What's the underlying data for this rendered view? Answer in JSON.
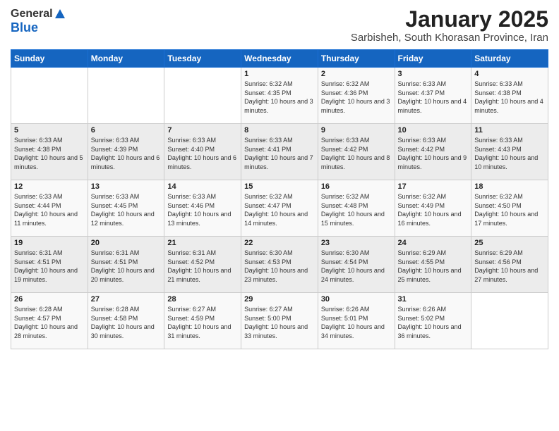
{
  "header": {
    "logo_general": "General",
    "logo_blue": "Blue",
    "title": "January 2025",
    "subtitle": "Sarbisheh, South Khorasan Province, Iran"
  },
  "days_of_week": [
    "Sunday",
    "Monday",
    "Tuesday",
    "Wednesday",
    "Thursday",
    "Friday",
    "Saturday"
  ],
  "weeks": [
    [
      {
        "day": "",
        "info": ""
      },
      {
        "day": "",
        "info": ""
      },
      {
        "day": "",
        "info": ""
      },
      {
        "day": "1",
        "info": "Sunrise: 6:32 AM\nSunset: 4:35 PM\nDaylight: 10 hours and 3 minutes."
      },
      {
        "day": "2",
        "info": "Sunrise: 6:32 AM\nSunset: 4:36 PM\nDaylight: 10 hours and 3 minutes."
      },
      {
        "day": "3",
        "info": "Sunrise: 6:33 AM\nSunset: 4:37 PM\nDaylight: 10 hours and 4 minutes."
      },
      {
        "day": "4",
        "info": "Sunrise: 6:33 AM\nSunset: 4:38 PM\nDaylight: 10 hours and 4 minutes."
      }
    ],
    [
      {
        "day": "5",
        "info": "Sunrise: 6:33 AM\nSunset: 4:38 PM\nDaylight: 10 hours and 5 minutes."
      },
      {
        "day": "6",
        "info": "Sunrise: 6:33 AM\nSunset: 4:39 PM\nDaylight: 10 hours and 6 minutes."
      },
      {
        "day": "7",
        "info": "Sunrise: 6:33 AM\nSunset: 4:40 PM\nDaylight: 10 hours and 6 minutes."
      },
      {
        "day": "8",
        "info": "Sunrise: 6:33 AM\nSunset: 4:41 PM\nDaylight: 10 hours and 7 minutes."
      },
      {
        "day": "9",
        "info": "Sunrise: 6:33 AM\nSunset: 4:42 PM\nDaylight: 10 hours and 8 minutes."
      },
      {
        "day": "10",
        "info": "Sunrise: 6:33 AM\nSunset: 4:42 PM\nDaylight: 10 hours and 9 minutes."
      },
      {
        "day": "11",
        "info": "Sunrise: 6:33 AM\nSunset: 4:43 PM\nDaylight: 10 hours and 10 minutes."
      }
    ],
    [
      {
        "day": "12",
        "info": "Sunrise: 6:33 AM\nSunset: 4:44 PM\nDaylight: 10 hours and 11 minutes."
      },
      {
        "day": "13",
        "info": "Sunrise: 6:33 AM\nSunset: 4:45 PM\nDaylight: 10 hours and 12 minutes."
      },
      {
        "day": "14",
        "info": "Sunrise: 6:33 AM\nSunset: 4:46 PM\nDaylight: 10 hours and 13 minutes."
      },
      {
        "day": "15",
        "info": "Sunrise: 6:32 AM\nSunset: 4:47 PM\nDaylight: 10 hours and 14 minutes."
      },
      {
        "day": "16",
        "info": "Sunrise: 6:32 AM\nSunset: 4:48 PM\nDaylight: 10 hours and 15 minutes."
      },
      {
        "day": "17",
        "info": "Sunrise: 6:32 AM\nSunset: 4:49 PM\nDaylight: 10 hours and 16 minutes."
      },
      {
        "day": "18",
        "info": "Sunrise: 6:32 AM\nSunset: 4:50 PM\nDaylight: 10 hours and 17 minutes."
      }
    ],
    [
      {
        "day": "19",
        "info": "Sunrise: 6:31 AM\nSunset: 4:51 PM\nDaylight: 10 hours and 19 minutes."
      },
      {
        "day": "20",
        "info": "Sunrise: 6:31 AM\nSunset: 4:51 PM\nDaylight: 10 hours and 20 minutes."
      },
      {
        "day": "21",
        "info": "Sunrise: 6:31 AM\nSunset: 4:52 PM\nDaylight: 10 hours and 21 minutes."
      },
      {
        "day": "22",
        "info": "Sunrise: 6:30 AM\nSunset: 4:53 PM\nDaylight: 10 hours and 23 minutes."
      },
      {
        "day": "23",
        "info": "Sunrise: 6:30 AM\nSunset: 4:54 PM\nDaylight: 10 hours and 24 minutes."
      },
      {
        "day": "24",
        "info": "Sunrise: 6:29 AM\nSunset: 4:55 PM\nDaylight: 10 hours and 25 minutes."
      },
      {
        "day": "25",
        "info": "Sunrise: 6:29 AM\nSunset: 4:56 PM\nDaylight: 10 hours and 27 minutes."
      }
    ],
    [
      {
        "day": "26",
        "info": "Sunrise: 6:28 AM\nSunset: 4:57 PM\nDaylight: 10 hours and 28 minutes."
      },
      {
        "day": "27",
        "info": "Sunrise: 6:28 AM\nSunset: 4:58 PM\nDaylight: 10 hours and 30 minutes."
      },
      {
        "day": "28",
        "info": "Sunrise: 6:27 AM\nSunset: 4:59 PM\nDaylight: 10 hours and 31 minutes."
      },
      {
        "day": "29",
        "info": "Sunrise: 6:27 AM\nSunset: 5:00 PM\nDaylight: 10 hours and 33 minutes."
      },
      {
        "day": "30",
        "info": "Sunrise: 6:26 AM\nSunset: 5:01 PM\nDaylight: 10 hours and 34 minutes."
      },
      {
        "day": "31",
        "info": "Sunrise: 6:26 AM\nSunset: 5:02 PM\nDaylight: 10 hours and 36 minutes."
      },
      {
        "day": "",
        "info": ""
      }
    ]
  ]
}
